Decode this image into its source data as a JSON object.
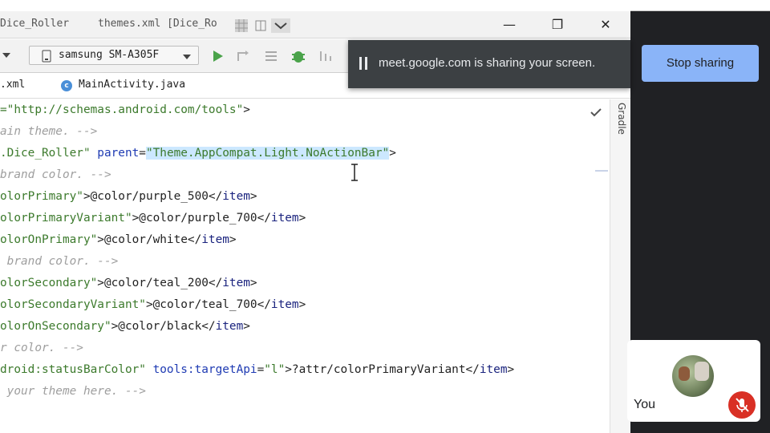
{
  "ide": {
    "tabs_title": {
      "project": "Dice_Roller",
      "file": "themes.xml [Dice_Ro"
    },
    "window_controls": {
      "minimize": "—",
      "restore": "❐",
      "close": "✕"
    },
    "toolbar": {
      "device": "samsung SM-A305F"
    },
    "file_tabs": [
      {
        "label": ".xml"
      },
      {
        "label": "MainActivity.java"
      }
    ],
    "side_panel_label": "Gradle",
    "code_lines": [
      {
        "segments": [
          {
            "cls": "v",
            "text": "=\"http://schemas.android.com/tools\""
          },
          {
            "cls": "p",
            "text": ">"
          }
        ]
      },
      {
        "segments": [
          {
            "cls": "c",
            "text": "ain theme. -->"
          }
        ]
      },
      {
        "segments": [
          {
            "cls": "v",
            "text": ".Dice_Roller\" "
          },
          {
            "cls": "a",
            "text": "parent"
          },
          {
            "cls": "p",
            "text": "="
          },
          {
            "cls": "v hl",
            "text": "\"Theme.AppCompat.Light.NoActionBar\""
          },
          {
            "cls": "p",
            "text": ">"
          }
        ]
      },
      {
        "segments": [
          {
            "cls": "c",
            "text": "brand color. -->"
          }
        ]
      },
      {
        "segments": [
          {
            "cls": "v",
            "text": "olorPrimary\""
          },
          {
            "cls": "p",
            "text": ">@color/purple_500</"
          },
          {
            "cls": "t",
            "text": "item"
          },
          {
            "cls": "p",
            "text": ">"
          }
        ]
      },
      {
        "segments": [
          {
            "cls": "v",
            "text": "olorPrimaryVariant\""
          },
          {
            "cls": "p",
            "text": ">@color/purple_700</"
          },
          {
            "cls": "t",
            "text": "item"
          },
          {
            "cls": "p",
            "text": ">"
          }
        ]
      },
      {
        "segments": [
          {
            "cls": "v",
            "text": "olorOnPrimary\""
          },
          {
            "cls": "p",
            "text": ">@color/white</"
          },
          {
            "cls": "t",
            "text": "item"
          },
          {
            "cls": "p",
            "text": ">"
          }
        ]
      },
      {
        "segments": [
          {
            "cls": "c",
            "text": " brand color. -->"
          }
        ]
      },
      {
        "segments": [
          {
            "cls": "v",
            "text": "olorSecondary\""
          },
          {
            "cls": "p",
            "text": ">@color/teal_200</"
          },
          {
            "cls": "t",
            "text": "item"
          },
          {
            "cls": "p",
            "text": ">"
          }
        ]
      },
      {
        "segments": [
          {
            "cls": "v",
            "text": "olorSecondaryVariant\""
          },
          {
            "cls": "p",
            "text": ">@color/teal_700</"
          },
          {
            "cls": "t",
            "text": "item"
          },
          {
            "cls": "p",
            "text": ">"
          }
        ]
      },
      {
        "segments": [
          {
            "cls": "v",
            "text": "olorOnSecondary\""
          },
          {
            "cls": "p",
            "text": ">@color/black</"
          },
          {
            "cls": "t",
            "text": "item"
          },
          {
            "cls": "p",
            "text": ">"
          }
        ]
      },
      {
        "segments": [
          {
            "cls": "c",
            "text": "r color. -->"
          }
        ]
      },
      {
        "segments": [
          {
            "cls": "v",
            "text": "droid:statusBarColor\" "
          },
          {
            "cls": "a",
            "text": "tools:targetApi"
          },
          {
            "cls": "p",
            "text": "="
          },
          {
            "cls": "v",
            "text": "\"l\""
          },
          {
            "cls": "p",
            "text": ">?attr/colorPrimaryVariant</"
          },
          {
            "cls": "t",
            "text": "item"
          },
          {
            "cls": "p",
            "text": ">"
          }
        ]
      },
      {
        "segments": [
          {
            "cls": "c",
            "text": " your theme here. -->"
          }
        ]
      }
    ]
  },
  "meet": {
    "share_message": "meet.google.com is sharing your screen.",
    "stop_sharing_label": "Stop sharing",
    "self_label": "You"
  },
  "colors": {
    "banner_bg": "#3c4043",
    "button_accent": "#8ab4f8",
    "mic_off_red": "#d93025"
  }
}
